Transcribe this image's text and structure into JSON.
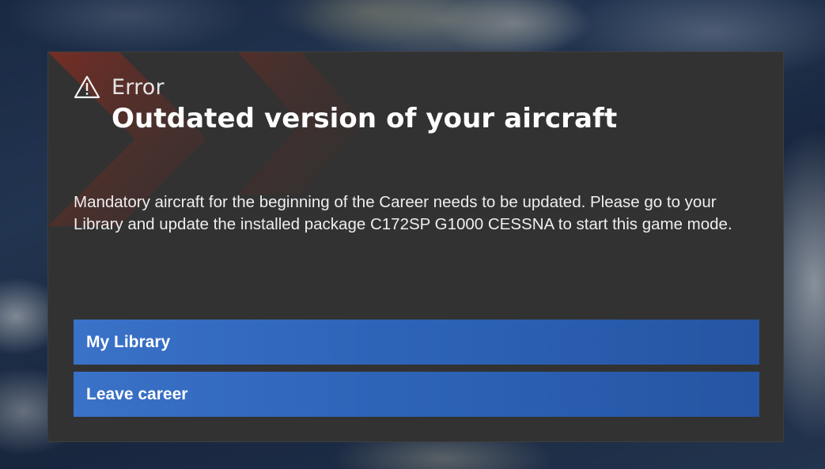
{
  "dialog": {
    "error_label": "Error",
    "title": "Outdated version of your aircraft",
    "message": "Mandatory aircraft for the beginning of the Career needs to be updated. Please go to your Library and update the installed package C172SP G1000 CESSNA to start this game mode.",
    "icon": "warning-triangle-icon"
  },
  "buttons": {
    "my_library": "My Library",
    "leave_career": "Leave career"
  },
  "colors": {
    "dialog_background": "#323232",
    "button_blue": "#2e64b8",
    "accent_red": "#8e2a1e"
  }
}
